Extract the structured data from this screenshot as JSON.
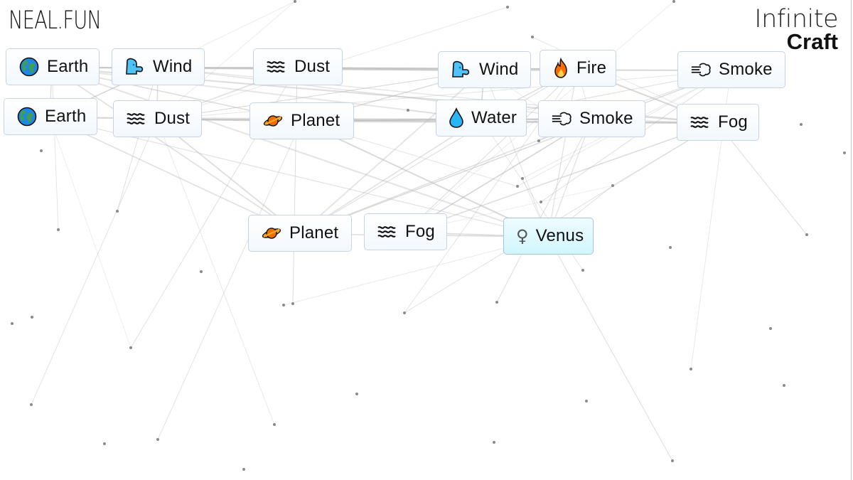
{
  "app": {
    "brand": "NEAL.FUN",
    "title_line1": "Infinite",
    "title_line2": "Craft"
  },
  "colors": {
    "item_border": "#c5d3e3",
    "item_bg": "#f2f8fd",
    "new_item_bg": "#d2f6fd",
    "line": "#cfcfcf",
    "dot": "#8a8a8a"
  },
  "canvas_items": [
    {
      "label": "Earth",
      "icon": "globe-icon",
      "emoji": "🌍",
      "new": false
    },
    {
      "label": "Wind",
      "icon": "wind-face-icon",
      "emoji": "🌬️",
      "new": false
    },
    {
      "label": "Dust",
      "icon": "wavy-lines-icon",
      "emoji": "🌫️",
      "new": false
    },
    {
      "label": "Wind",
      "icon": "wind-face-icon",
      "emoji": "🌬️",
      "new": false
    },
    {
      "label": "Fire",
      "icon": "fire-icon",
      "emoji": "🔥",
      "new": false
    },
    {
      "label": "Smoke",
      "icon": "dash-puff-icon",
      "emoji": "💨",
      "new": false
    },
    {
      "label": "Earth",
      "icon": "globe-icon",
      "emoji": "🌍",
      "new": false
    },
    {
      "label": "Dust",
      "icon": "wavy-lines-icon",
      "emoji": "🌫️",
      "new": false
    },
    {
      "label": "Planet",
      "icon": "ringed-planet-icon",
      "emoji": "🪐",
      "new": false
    },
    {
      "label": "Water",
      "icon": "droplet-icon",
      "emoji": "💧",
      "new": false
    },
    {
      "label": "Smoke",
      "icon": "dash-puff-icon",
      "emoji": "💨",
      "new": false
    },
    {
      "label": "Fog",
      "icon": "wavy-lines-icon",
      "emoji": "🌫️",
      "new": false
    },
    {
      "label": "Planet",
      "icon": "ringed-planet-icon",
      "emoji": "🪐",
      "new": false
    },
    {
      "label": "Fog",
      "icon": "wavy-lines-icon",
      "emoji": "🌫️",
      "new": false
    },
    {
      "label": "Venus",
      "icon": "female-sign-icon",
      "emoji": "♀",
      "new": true
    }
  ]
}
